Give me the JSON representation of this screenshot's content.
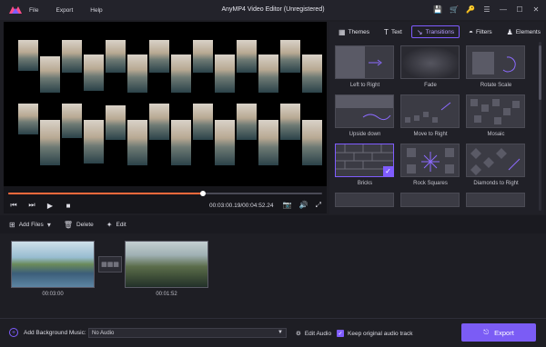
{
  "app": {
    "title": "AnyMP4 Video Editor (Unregistered)",
    "menu": [
      "File",
      "Export",
      "Help"
    ],
    "accent": "#7f5cff"
  },
  "window_controls": [
    "save-icon",
    "cart-icon",
    "key-icon",
    "menu-icon",
    "minimize-icon",
    "maximize-icon",
    "close-icon"
  ],
  "player": {
    "progress": 0.62,
    "time": "00:03:00.19/00:04:52.24",
    "buttons": [
      "rewind-icon",
      "step-forward-icon",
      "play-icon",
      "stop-icon"
    ],
    "right_buttons": [
      "snapshot-icon",
      "volume-icon",
      "fullscreen-icon"
    ]
  },
  "panel": {
    "tabs": [
      {
        "label": "Themes",
        "icon": "themes-icon"
      },
      {
        "label": "Text",
        "icon": "text-icon"
      },
      {
        "label": "Transitions",
        "icon": "transitions-icon",
        "active": true
      },
      {
        "label": "Filters",
        "icon": "filters-icon"
      },
      {
        "label": "Elements",
        "icon": "elements-icon"
      }
    ],
    "transitions": [
      {
        "label": "Left to Right"
      },
      {
        "label": "Fade"
      },
      {
        "label": "Rotate Scale"
      },
      {
        "label": "Upside down"
      },
      {
        "label": "Move to Right"
      },
      {
        "label": "Mosaic"
      },
      {
        "label": "Bricks",
        "selected": true
      },
      {
        "label": "Rock Squares"
      },
      {
        "label": "Diamonds to Right"
      }
    ]
  },
  "toolbar": {
    "add_files": "Add Files",
    "delete": "Delete",
    "edit": "Edit"
  },
  "timeline": {
    "clips": [
      {
        "duration": "00:03:00"
      },
      {
        "duration": "00:01:52"
      }
    ]
  },
  "bottom": {
    "add_music_label": "Add Background Music:",
    "audio_value": "No Audio",
    "edit_audio": "Edit Audio",
    "keep_audio": "Keep original audio track",
    "keep_audio_checked": true,
    "export": "Export"
  }
}
